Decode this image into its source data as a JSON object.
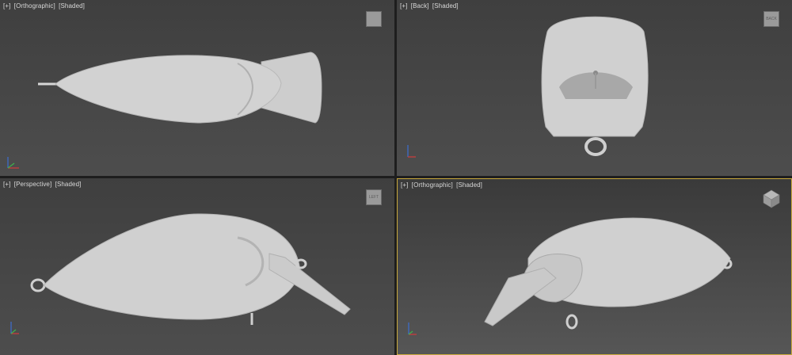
{
  "viewports": [
    {
      "id": "top-left",
      "menu": "[+]",
      "view": "[Orthographic]",
      "shading": "[Shaded]",
      "cube": ""
    },
    {
      "id": "top-right",
      "menu": "[+]",
      "view": "[Back]",
      "shading": "[Shaded]",
      "cube": "BACK"
    },
    {
      "id": "bottom-left",
      "menu": "[+]",
      "view": "[Perspective]",
      "shading": "[Shaded]",
      "cube": "LEFT"
    },
    {
      "id": "bottom-right",
      "menu": "[+]",
      "view": "[Orthographic]",
      "shading": "[Shaded]",
      "cube": ""
    }
  ],
  "colors": {
    "active_border": "#c9a93c",
    "model": "#cfcfcf",
    "axis_x": "#d23c3c",
    "axis_y": "#3cb44b",
    "axis_z": "#3c6fd2"
  },
  "icons": [
    "viewcube-icon",
    "axis-tripod-icon"
  ]
}
